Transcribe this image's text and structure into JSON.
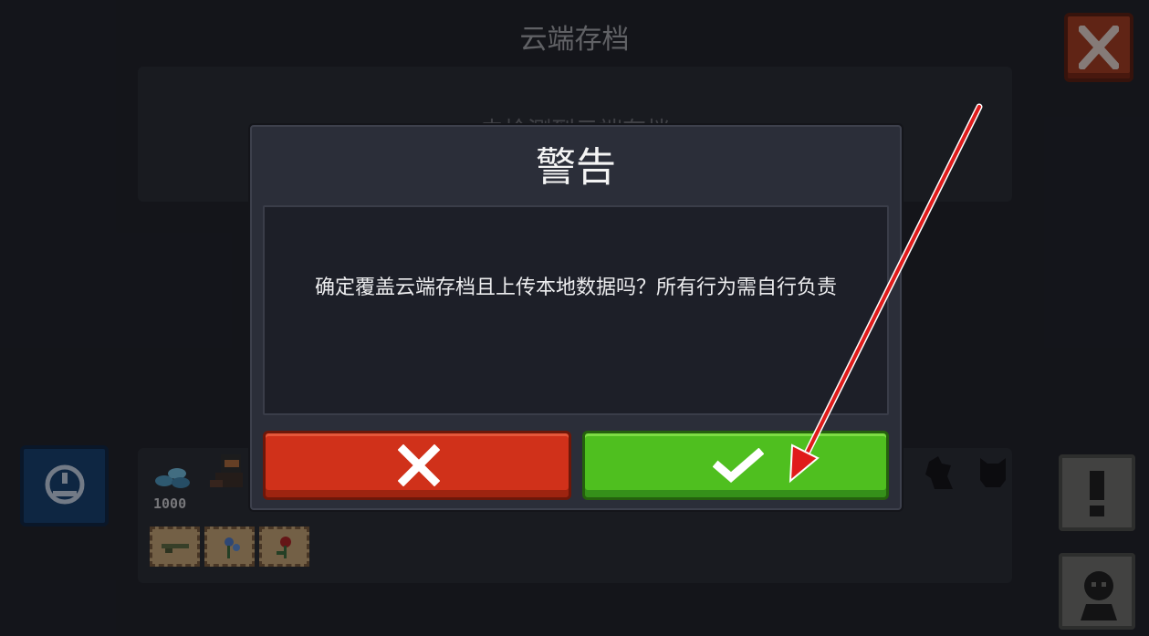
{
  "page": {
    "title": "云端存档"
  },
  "status": {
    "text": "未检测到云端存档"
  },
  "save_slot": {
    "gem_count": "1000"
  },
  "dialog": {
    "title": "警告",
    "message": "确定覆盖云端存档且上传本地数据吗？所有行为需自行负责",
    "cancel_icon": "x-icon",
    "confirm_icon": "checkmark-icon"
  },
  "colors": {
    "cancel": "#d0311a",
    "confirm": "#4fbf1f",
    "close": "#a73a1d",
    "annotation_arrow": "#e01b1b"
  }
}
